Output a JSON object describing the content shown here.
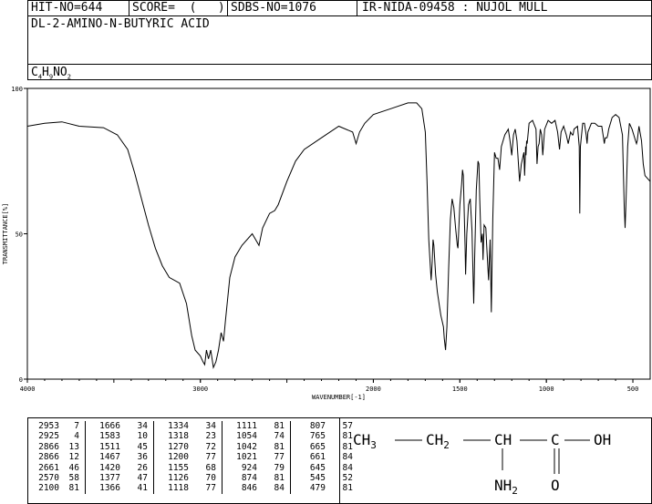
{
  "header": {
    "hit_no": "HIT-NO=644",
    "score": "SCORE=  (   )",
    "sdbs_no": "SDBS-NO=1076",
    "ir_info": "IR-NIDA-09458 : NUJOL MULL",
    "compound_name": "DL-2-AMINO-N-BUTYRIC ACID",
    "formula": {
      "c": "C",
      "c_n": "4",
      "h": "H",
      "h_n": "9",
      "n": "N",
      "o": "O",
      "o_n": "2"
    }
  },
  "chart_data": {
    "type": "line",
    "xlabel": "WAVENUMBER[-1]",
    "ylabel": "TRANSMITTANCE[%]",
    "xlim": [
      4000,
      400
    ],
    "ylim": [
      0,
      100
    ],
    "x_ticks": [
      4000,
      3000,
      2000,
      1500,
      1000,
      500
    ],
    "y_ticks": [
      0,
      50,
      100
    ],
    "series": [
      {
        "points": [
          [
            4000,
            87
          ],
          [
            3900,
            88
          ],
          [
            3800,
            88.5
          ],
          [
            3700,
            87
          ],
          [
            3560,
            86.5
          ],
          [
            3480,
            84
          ],
          [
            3420,
            79
          ],
          [
            3380,
            71
          ],
          [
            3340,
            62
          ],
          [
            3300,
            53
          ],
          [
            3260,
            45
          ],
          [
            3220,
            39
          ],
          [
            3180,
            35
          ],
          [
            3120,
            33
          ],
          [
            3080,
            26
          ],
          [
            3050,
            15
          ],
          [
            3030,
            10
          ],
          [
            3000,
            8
          ],
          [
            2985,
            6
          ],
          [
            2975,
            5
          ],
          [
            2965,
            10
          ],
          [
            2953,
            7
          ],
          [
            2940,
            10
          ],
          [
            2925,
            4
          ],
          [
            2910,
            6
          ],
          [
            2895,
            10
          ],
          [
            2880,
            16
          ],
          [
            2866,
            13
          ],
          [
            2855,
            20
          ],
          [
            2830,
            35
          ],
          [
            2800,
            42
          ],
          [
            2760,
            46
          ],
          [
            2700,
            50
          ],
          [
            2661,
            46
          ],
          [
            2640,
            52
          ],
          [
            2600,
            57
          ],
          [
            2570,
            58
          ],
          [
            2550,
            60
          ],
          [
            2500,
            68
          ],
          [
            2450,
            75
          ],
          [
            2400,
            79
          ],
          [
            2300,
            83
          ],
          [
            2200,
            87
          ],
          [
            2120,
            85
          ],
          [
            2100,
            81
          ],
          [
            2080,
            85
          ],
          [
            2050,
            88
          ],
          [
            2000,
            91
          ],
          [
            1900,
            93
          ],
          [
            1800,
            95
          ],
          [
            1750,
            95
          ],
          [
            1720,
            93
          ],
          [
            1700,
            85
          ],
          [
            1690,
            68
          ],
          [
            1680,
            48
          ],
          [
            1674,
            42
          ],
          [
            1666,
            34
          ],
          [
            1660,
            40
          ],
          [
            1655,
            48
          ],
          [
            1650,
            46
          ],
          [
            1640,
            36
          ],
          [
            1630,
            30
          ],
          [
            1620,
            26
          ],
          [
            1610,
            22
          ],
          [
            1595,
            18
          ],
          [
            1590,
            14
          ],
          [
            1583,
            10
          ],
          [
            1575,
            18
          ],
          [
            1565,
            38
          ],
          [
            1555,
            55
          ],
          [
            1545,
            62
          ],
          [
            1535,
            59
          ],
          [
            1525,
            52
          ],
          [
            1515,
            46
          ],
          [
            1511,
            45
          ],
          [
            1500,
            60
          ],
          [
            1490,
            67
          ],
          [
            1485,
            72
          ],
          [
            1480,
            70
          ],
          [
            1470,
            46
          ],
          [
            1467,
            36
          ],
          [
            1460,
            50
          ],
          [
            1450,
            60
          ],
          [
            1440,
            62
          ],
          [
            1430,
            51
          ],
          [
            1420,
            26
          ],
          [
            1415,
            40
          ],
          [
            1405,
            65
          ],
          [
            1395,
            75
          ],
          [
            1390,
            74
          ],
          [
            1385,
            62
          ],
          [
            1377,
            47
          ],
          [
            1370,
            50
          ],
          [
            1366,
            41
          ],
          [
            1360,
            53
          ],
          [
            1350,
            52
          ],
          [
            1345,
            46
          ],
          [
            1334,
            34
          ],
          [
            1325,
            48
          ],
          [
            1318,
            23
          ],
          [
            1310,
            55
          ],
          [
            1300,
            78
          ],
          [
            1290,
            76
          ],
          [
            1280,
            76
          ],
          [
            1270,
            72
          ],
          [
            1260,
            80
          ],
          [
            1240,
            84
          ],
          [
            1220,
            86
          ],
          [
            1210,
            82
          ],
          [
            1200,
            77
          ],
          [
            1190,
            84
          ],
          [
            1180,
            86
          ],
          [
            1170,
            82
          ],
          [
            1155,
            68
          ],
          [
            1145,
            74
          ],
          [
            1130,
            78
          ],
          [
            1126,
            70
          ],
          [
            1120,
            80
          ],
          [
            1118,
            77
          ],
          [
            1114,
            82
          ],
          [
            1111,
            81
          ],
          [
            1100,
            88
          ],
          [
            1080,
            89
          ],
          [
            1060,
            86
          ],
          [
            1054,
            74
          ],
          [
            1048,
            80
          ],
          [
            1042,
            81
          ],
          [
            1035,
            86
          ],
          [
            1027,
            84
          ],
          [
            1021,
            77
          ],
          [
            1010,
            86
          ],
          [
            990,
            89
          ],
          [
            970,
            88
          ],
          [
            950,
            89
          ],
          [
            935,
            85
          ],
          [
            924,
            79
          ],
          [
            915,
            85
          ],
          [
            900,
            87
          ],
          [
            885,
            84
          ],
          [
            874,
            81
          ],
          [
            860,
            85
          ],
          [
            850,
            84
          ],
          [
            846,
            84
          ],
          [
            840,
            86
          ],
          [
            820,
            87
          ],
          [
            810,
            80
          ],
          [
            807,
            57
          ],
          [
            803,
            80
          ],
          [
            790,
            88
          ],
          [
            780,
            88
          ],
          [
            770,
            84
          ],
          [
            765,
            81
          ],
          [
            760,
            85
          ],
          [
            740,
            88
          ],
          [
            720,
            88
          ],
          [
            700,
            87
          ],
          [
            680,
            87
          ],
          [
            670,
            83
          ],
          [
            665,
            81
          ],
          [
            660,
            83
          ],
          [
            650,
            83
          ],
          [
            645,
            84
          ],
          [
            640,
            86
          ],
          [
            620,
            90
          ],
          [
            600,
            91
          ],
          [
            580,
            90
          ],
          [
            560,
            84
          ],
          [
            550,
            60
          ],
          [
            545,
            52
          ],
          [
            540,
            60
          ],
          [
            530,
            80
          ],
          [
            520,
            88
          ],
          [
            505,
            86
          ],
          [
            495,
            84
          ],
          [
            485,
            82
          ],
          [
            479,
            81
          ],
          [
            475,
            82
          ],
          [
            465,
            87
          ],
          [
            450,
            82
          ],
          [
            440,
            74
          ],
          [
            430,
            70
          ],
          [
            415,
            69
          ],
          [
            400,
            68
          ]
        ]
      }
    ]
  },
  "peaks": [
    [
      [
        "2953",
        "7"
      ],
      [
        "2925",
        "4"
      ],
      [
        "2866",
        "13"
      ],
      [
        "2866",
        "12"
      ],
      [
        "2661",
        "46"
      ],
      [
        "2570",
        "58"
      ],
      [
        "2100",
        "81"
      ]
    ],
    [
      [
        "1666",
        "34"
      ],
      [
        "1583",
        "10"
      ],
      [
        "1511",
        "45"
      ],
      [
        "1467",
        "36"
      ],
      [
        "1420",
        "26"
      ],
      [
        "1377",
        "47"
      ],
      [
        "1366",
        "41"
      ]
    ],
    [
      [
        "1334",
        "34"
      ],
      [
        "1318",
        "23"
      ],
      [
        "1270",
        "72"
      ],
      [
        "1200",
        "77"
      ],
      [
        "1155",
        "68"
      ],
      [
        "1126",
        "70"
      ],
      [
        "1118",
        "77"
      ]
    ],
    [
      [
        "1111",
        "81"
      ],
      [
        "1054",
        "74"
      ],
      [
        "1042",
        "81"
      ],
      [
        "1021",
        "77"
      ],
      [
        "924",
        "79"
      ],
      [
        "874",
        "81"
      ],
      [
        "846",
        "84"
      ]
    ],
    [
      [
        "807",
        "57"
      ],
      [
        "765",
        "81"
      ],
      [
        "665",
        "81"
      ],
      [
        "661",
        "84"
      ],
      [
        "645",
        "84"
      ],
      [
        "545",
        "52"
      ],
      [
        "479",
        "81"
      ]
    ]
  ],
  "structure": {
    "ch3": "CH",
    "ch3_sub": "3",
    "ch2": "CH",
    "ch2_sub": "2",
    "ch": "CH",
    "c": "C",
    "oh": "OH",
    "nh2": "NH",
    "nh2_sub": "2",
    "o": "O"
  }
}
